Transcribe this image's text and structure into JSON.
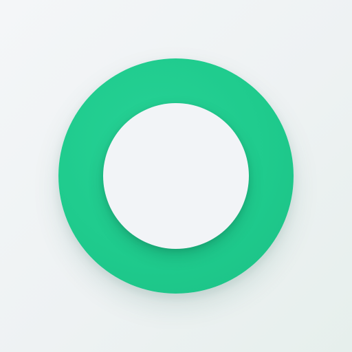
{
  "icon": {
    "name": "ring-icon",
    "ring_color": "#1fcb8d",
    "center_color": "#f2f4f7",
    "background_color": "#eef2f3"
  }
}
